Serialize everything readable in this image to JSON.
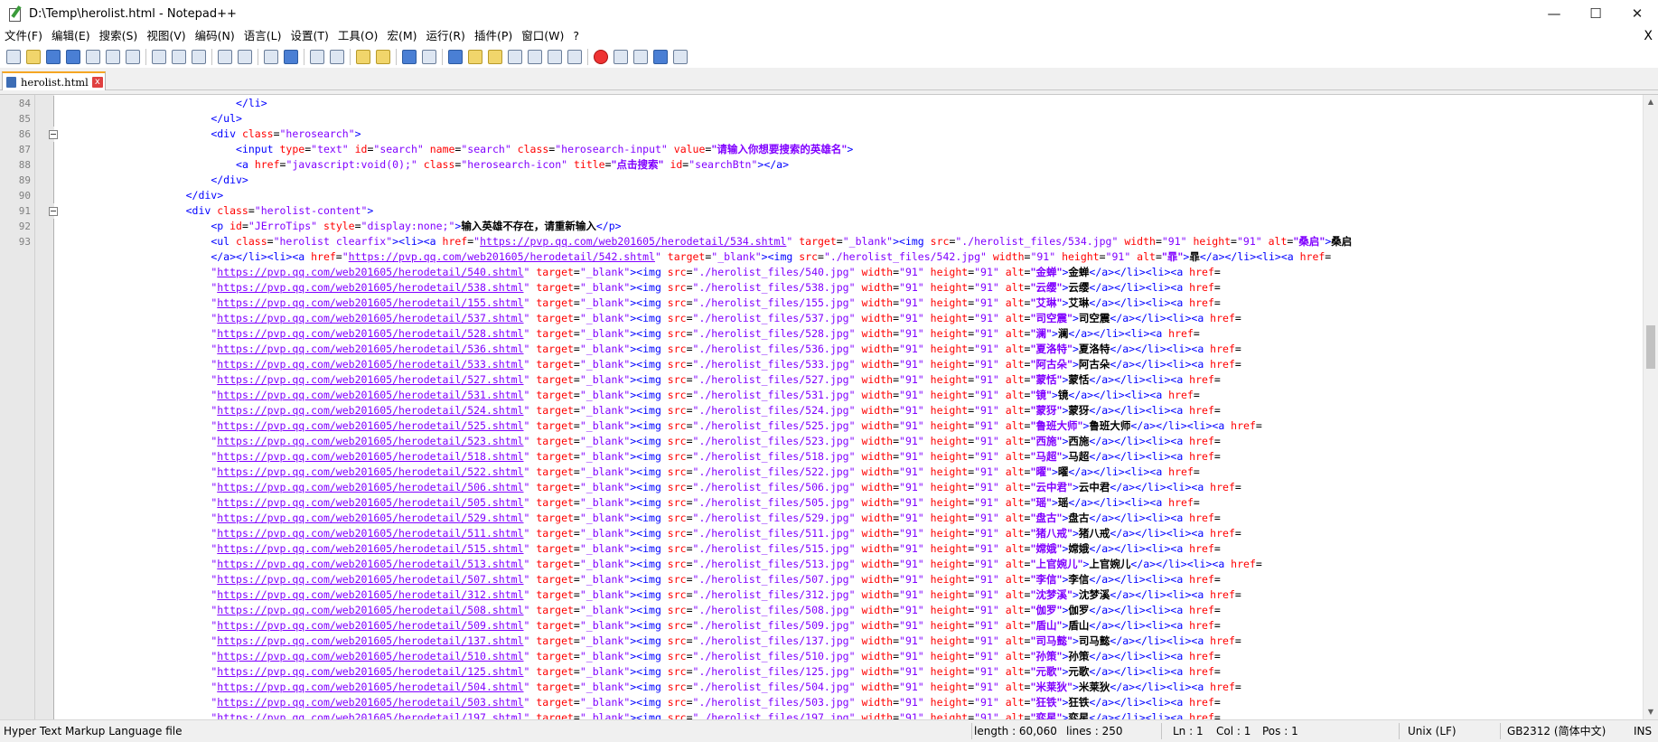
{
  "window": {
    "title": "D:\\Temp\\herolist.html - Notepad++",
    "minimize": "—",
    "maximize": "☐",
    "close": "✕"
  },
  "menu": {
    "items": [
      "文件(F)",
      "编辑(E)",
      "搜索(S)",
      "视图(V)",
      "编码(N)",
      "语言(L)",
      "设置(T)",
      "工具(O)",
      "宏(M)",
      "运行(R)",
      "插件(P)",
      "窗口(W)",
      "?"
    ],
    "close": "X"
  },
  "tab": {
    "label": "herolist.html",
    "close": "x"
  },
  "status": {
    "file_type": "Hyper Text Markup Language file",
    "length": "length : 60,060",
    "lines": "lines : 250",
    "ln": "Ln : 1",
    "col": "Col : 1",
    "pos": "Pos : 1",
    "eol": "Unix (LF)",
    "encoding": "GB2312 (简体中文)",
    "mode": "INS"
  },
  "code": {
    "line_numbers": [
      "84",
      "85",
      "86",
      "87",
      "88",
      "89",
      "90",
      "91",
      "92",
      "93"
    ],
    "l84": "</li>",
    "l85": "</ul>",
    "l86": [
      "<div ",
      "class",
      "=",
      "\"herosearch\"",
      ">"
    ],
    "l87": [
      "<input ",
      "type",
      "=",
      "\"text\"",
      " id",
      "=",
      "\"search\"",
      " name",
      "=",
      "\"search\"",
      " class",
      "=",
      "\"herosearch-input\"",
      " value",
      "=",
      "\"请输入你想要搜索的英雄名\"",
      ">"
    ],
    "l88": [
      "<a ",
      "href",
      "=",
      "\"javascript:void(0);\"",
      " class",
      "=",
      "\"herosearch-icon\"",
      " title",
      "=",
      "\"点击搜索\"",
      " id",
      "=",
      "\"searchBtn\"",
      "></a>"
    ],
    "l89": "</div>",
    "l90": "</div>",
    "l91": [
      "<div ",
      "class",
      "=",
      "\"herolist-content\"",
      ">"
    ],
    "l92": [
      "<p ",
      "id",
      "=",
      "\"JErroTips\"",
      " style",
      "=",
      "\"display:none;\"",
      ">",
      "输入英雄不存在，请重新输入",
      "</p>"
    ],
    "l93_first": [
      "<ul ",
      "class",
      "=",
      "\"herolist clearfix\"",
      "><li><a ",
      "href",
      "=",
      "\"",
      "https://pvp.qq.com/web201605/herodetail/534.shtml",
      "\"",
      " target",
      "=",
      "\"_blank\"",
      "><img ",
      "src",
      "=",
      "\"./herolist_files/534.jpg\"",
      " width",
      "=",
      "\"91\"",
      " height",
      "=",
      "\"91\"",
      " alt",
      "=",
      "\"桑启\"",
      ">",
      "桑启"
    ],
    "l93_second": [
      "</a></li><li><a ",
      "href",
      "=",
      "\"",
      "https://pvp.qq.com/web201605/herodetail/542.shtml",
      "\"",
      " target",
      "=",
      "\"_blank\"",
      "><img ",
      "src",
      "=",
      "\"./herolist_files/542.jpg\"",
      " width",
      "=",
      "\"91\"",
      " height",
      "=",
      "\"91\"",
      " alt",
      "=",
      "\"暃\"",
      ">",
      "暃",
      "</a></li><li><a ",
      "href",
      "="
    ],
    "heroes": [
      {
        "id": "540",
        "name": "金蝉"
      },
      {
        "id": "538",
        "name": "云缨"
      },
      {
        "id": "155",
        "name": "艾琳"
      },
      {
        "id": "537",
        "name": "司空震"
      },
      {
        "id": "528",
        "name": "澜"
      },
      {
        "id": "536",
        "name": "夏洛特"
      },
      {
        "id": "533",
        "name": "阿古朵"
      },
      {
        "id": "527",
        "name": "蒙恬"
      },
      {
        "id": "531",
        "name": "镜"
      },
      {
        "id": "524",
        "name": "蒙犽"
      },
      {
        "id": "525",
        "name": "鲁班大师"
      },
      {
        "id": "523",
        "name": "西施"
      },
      {
        "id": "518",
        "name": "马超"
      },
      {
        "id": "522",
        "name": "曜"
      },
      {
        "id": "506",
        "name": "云中君"
      },
      {
        "id": "505",
        "name": "瑶"
      },
      {
        "id": "529",
        "name": "盘古"
      },
      {
        "id": "511",
        "name": "猪八戒"
      },
      {
        "id": "515",
        "name": "嫦娥"
      },
      {
        "id": "513",
        "name": "上官婉儿"
      },
      {
        "id": "507",
        "name": "李信"
      },
      {
        "id": "312",
        "name": "沈梦溪"
      },
      {
        "id": "508",
        "name": "伽罗"
      },
      {
        "id": "509",
        "name": "盾山"
      },
      {
        "id": "137",
        "name": "司马懿"
      },
      {
        "id": "510",
        "name": "孙策"
      },
      {
        "id": "125",
        "name": "元歌"
      },
      {
        "id": "504",
        "name": "米莱狄"
      },
      {
        "id": "503",
        "name": "狂铁"
      },
      {
        "id": "197",
        "name": "弈星"
      }
    ],
    "hero_url_prefix": "https://pvp.qq.com/web201605/herodetail/",
    "hero_url_suffix": ".shtml",
    "hero_img_prefix": "./herolist_files/",
    "hero_img_suffix": ".jpg"
  },
  "colors": {
    "tag": "#0000ff",
    "attribute": "#ff0000",
    "string": "#8000ff",
    "text": "#000000",
    "tab_accent": "#f5a623"
  },
  "icons": [
    "new-file-icon",
    "open-file-icon",
    "save-icon",
    "save-all-icon",
    "close-icon",
    "close-all-icon",
    "print-icon",
    "cut-icon",
    "copy-icon",
    "paste-icon",
    "undo-icon",
    "redo-icon",
    "find-icon",
    "replace-icon",
    "zoom-in-icon",
    "zoom-out-icon",
    "sync-v-icon",
    "sync-h-icon",
    "word-wrap-icon",
    "show-all-chars-icon",
    "indent-guide-icon",
    "udl-icon",
    "doc-map-icon",
    "function-list-icon",
    "folder-workspace-icon",
    "monitoring-icon",
    "record-macro-icon",
    "stop-macro-icon",
    "play-macro-icon",
    "run-multiple-macro-icon",
    "save-macro-icon"
  ]
}
